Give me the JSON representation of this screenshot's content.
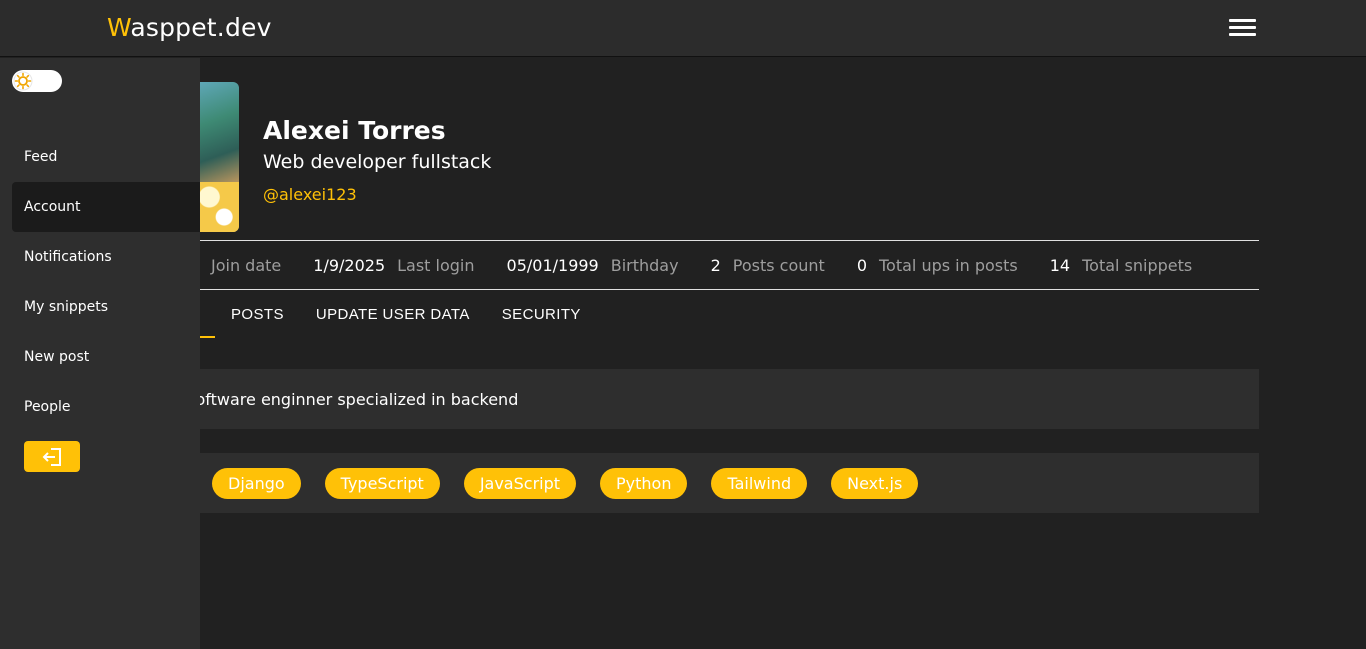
{
  "brand": {
    "first_letter": "W",
    "rest": "asppet.dev"
  },
  "header": {
    "menu_icon": "hamburger-menu-icon"
  },
  "theme_toggle": {
    "icon": "sun-icon",
    "state": "light"
  },
  "sidebar": {
    "items": [
      {
        "label": "Feed",
        "active": false
      },
      {
        "label": "Account",
        "active": true
      },
      {
        "label": "Notifications",
        "active": false
      },
      {
        "label": "My snippets",
        "active": false
      },
      {
        "label": "New post",
        "active": false
      },
      {
        "label": "People",
        "active": false
      }
    ],
    "logout_icon": "logout-arrow-icon"
  },
  "profile": {
    "name": "Alexei Torres",
    "role": "Web developer fullstack",
    "handle": "@alexei123"
  },
  "stats": [
    {
      "value": "",
      "label": "Join date"
    },
    {
      "value": "1/9/2025",
      "label": "Last login"
    },
    {
      "value": "05/01/1999",
      "label": "Birthday"
    },
    {
      "value": "2",
      "label": "Posts count"
    },
    {
      "value": "0",
      "label": "Total ups in posts"
    },
    {
      "value": "14",
      "label": "Total snippets"
    }
  ],
  "tabs": [
    {
      "label": "",
      "active": true
    },
    {
      "label": "POSTS",
      "active": false
    },
    {
      "label": "UPDATE USER DATA",
      "active": false
    },
    {
      "label": "SECURITY",
      "active": false
    }
  ],
  "bio": "ck software enginner specialized in backend",
  "skills": [
    "Django",
    "TypeScript",
    "JavaScript",
    "Python",
    "Tailwind",
    "Next.js"
  ],
  "colors": {
    "accent": "#ffc107",
    "background": "#212121",
    "panel": "#2e2e2e",
    "topbar": "#2c2c2c",
    "muted_text": "#9e9e9e"
  }
}
